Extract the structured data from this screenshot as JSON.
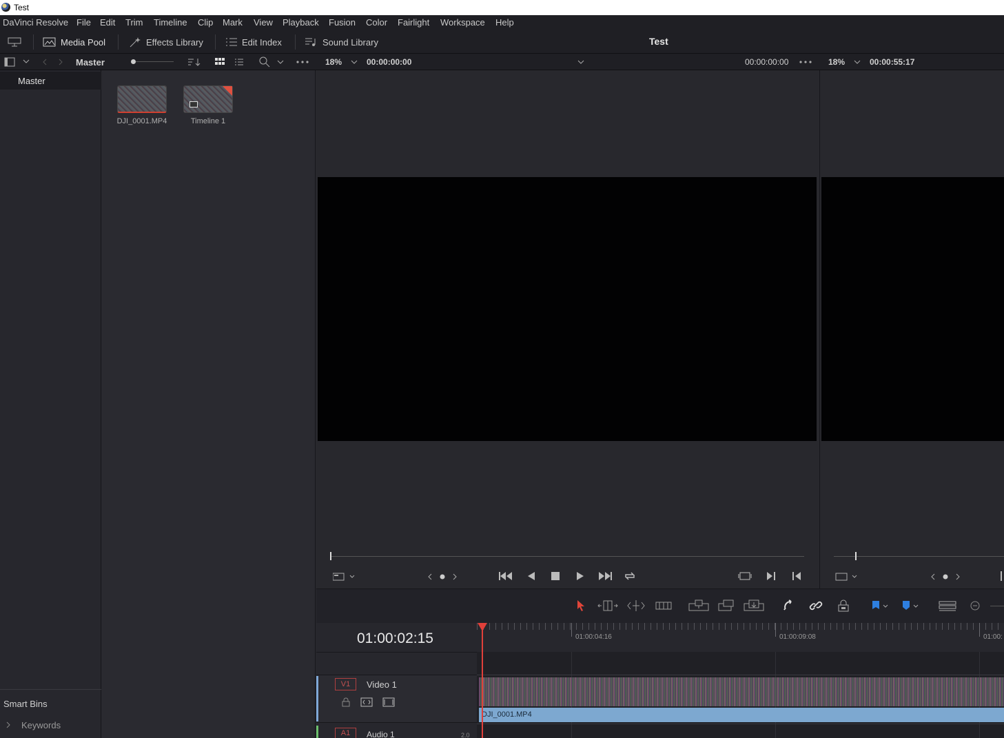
{
  "window": {
    "title": "Test"
  },
  "menu": [
    "DaVinci Resolve",
    "File",
    "Edit",
    "Trim",
    "Timeline",
    "Clip",
    "Mark",
    "View",
    "Playback",
    "Fusion",
    "Color",
    "Fairlight",
    "Workspace",
    "Help"
  ],
  "toolbar": {
    "media_pool": "Media Pool",
    "effects_library": "Effects Library",
    "edit_index": "Edit Index",
    "sound_library": "Sound Library",
    "project_title": "Test"
  },
  "subbar": {
    "bin_name": "Master",
    "zoom_source": "18%",
    "source_timecode": "00:00:00:00",
    "dur_timecode": "00:00:00:00",
    "zoom_program": "18%",
    "program_timecode": "00:00:55:17"
  },
  "bins": {
    "master": "Master",
    "smart_bins": "Smart Bins",
    "keywords": "Keywords"
  },
  "clips": [
    {
      "name": "DJI_0001.MP4"
    },
    {
      "name": "Timeline 1"
    }
  ],
  "timeline": {
    "timecode": "01:00:02:15",
    "ruler": [
      "01:00:04:16",
      "01:00:09:08",
      "01:00:"
    ],
    "tracks": [
      {
        "id": "V1",
        "name": "Video 1"
      },
      {
        "id": "A1",
        "name": "Audio 1",
        "channels": "2.0"
      }
    ],
    "clip_name": "DJI_0001.MP4"
  }
}
